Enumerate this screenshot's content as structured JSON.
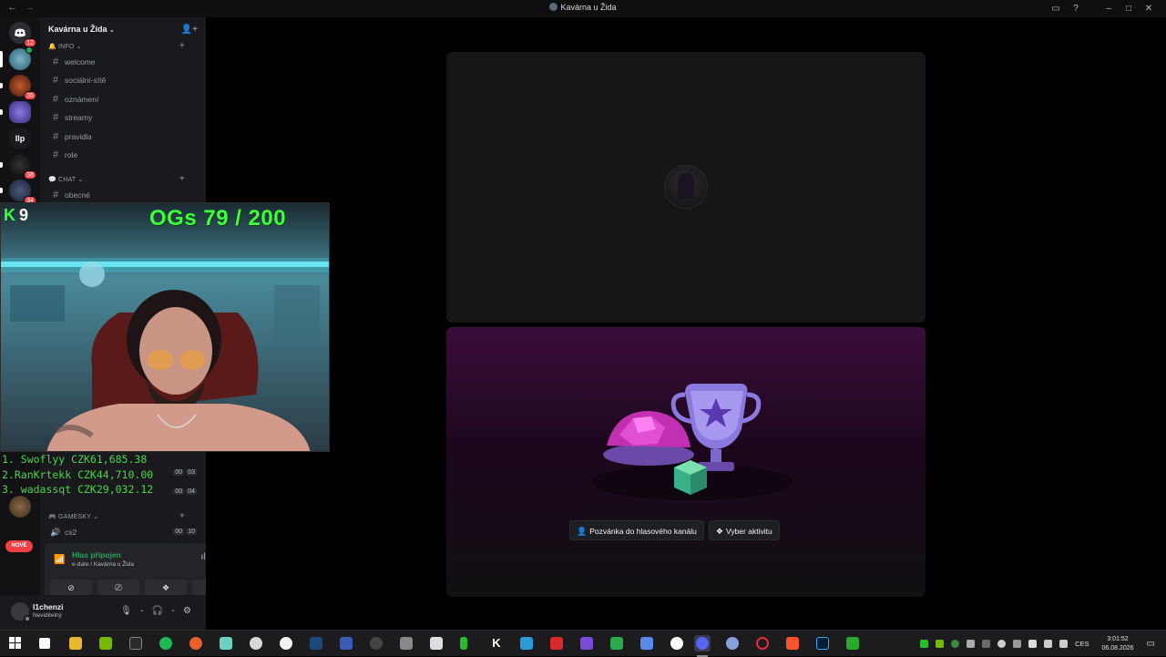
{
  "window": {
    "title": "Kavárna u Žida",
    "nav_back": "←",
    "nav_forward": "→",
    "inbox_icon": "▭",
    "help_icon": "?",
    "minimize": "–",
    "maximize": "□",
    "close": "✕"
  },
  "guilds": {
    "dm_badge": "12",
    "server2_badge": "35",
    "llp_label": "llp",
    "server5_badge": "38",
    "server6_badge": "34",
    "new_label": "NOVÉ"
  },
  "server": {
    "name": "Kavárna u Žida",
    "chevron": "⌄",
    "invite_icon": "👤+"
  },
  "categories": {
    "info": "🔔 INFO ⌄",
    "chat": "💬 CHAT ⌄",
    "gamesky": "🎮 GAMESKY ⌄"
  },
  "channels": {
    "info": [
      "welcome",
      "sociální-sítě",
      "oznámení",
      "streamy",
      "pravidla",
      "role"
    ],
    "chat": [
      "obecné"
    ],
    "gamesky": [
      "cs2"
    ]
  },
  "voice_times": {
    "row1": [
      "00",
      "03"
    ],
    "row2": [
      "00",
      "04"
    ],
    "cs2": [
      "00",
      "10"
    ]
  },
  "voice_panel": {
    "status": "Hlas připojen",
    "location": "e-date / Kavárna u Žida"
  },
  "user": {
    "name": "l1chenzi",
    "status": "Neviditelný"
  },
  "stream": {
    "kills_icon": "K",
    "kills_value": "9",
    "ogs": "OGs 79 / 200",
    "leaderboard": [
      "1. Swoflyy CZK61,685.38",
      "2.RanKrtekk CZK44,710.00",
      "3. wadassqt CZK29,032.12"
    ]
  },
  "actions": {
    "invite_label": "Pozvánka do hlasového kanálu",
    "activity_label": "Vyber aktivitu"
  },
  "tray": {
    "language": "CES",
    "time": "3:01:52",
    "date": "06.08.2026"
  },
  "colors": {
    "accent_green": "#3dff3d",
    "connected_green": "#23a55a",
    "badge_red": "#f23f43",
    "background": "#000000"
  }
}
